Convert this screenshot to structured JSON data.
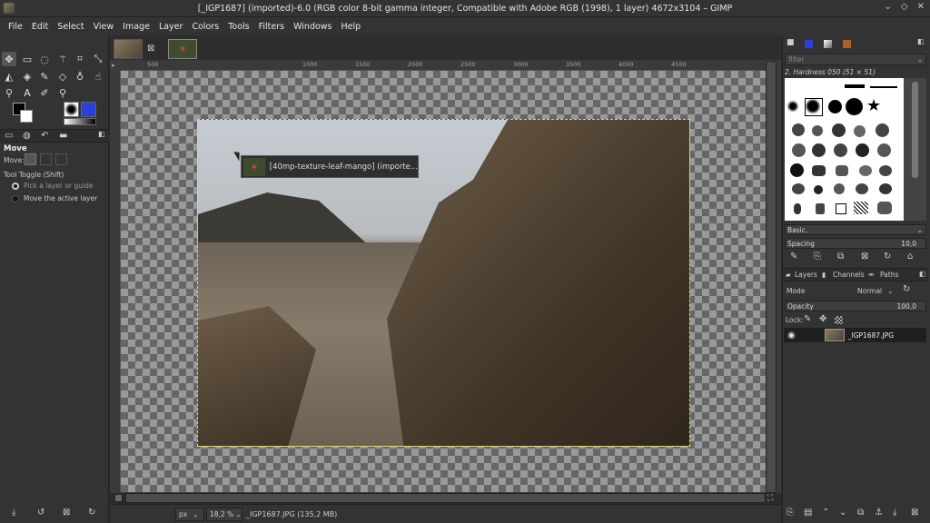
{
  "window": {
    "title": "[_IGP1687] (imported)-6.0 (RGB color 8-bit gamma integer, Compatible with Adobe RGB (1998), 1 layer) 4672x3104 – GIMP",
    "controls": [
      "⌄",
      "◇",
      "✕"
    ]
  },
  "menu": [
    "File",
    "Edit",
    "Select",
    "View",
    "Image",
    "Layer",
    "Colors",
    "Tools",
    "Filters",
    "Windows",
    "Help"
  ],
  "tool_options": {
    "title": "Move",
    "move_label": "Move:",
    "toggle_label": "Tool Toggle  (Shift)",
    "options": [
      {
        "label": "Pick a layer or guide",
        "selected": true
      },
      {
        "label": "Move the active layer",
        "selected": false
      }
    ]
  },
  "ruler_ticks": [
    "500",
    "1000",
    "1500",
    "2000",
    "2500",
    "3000",
    "3500",
    "4000",
    "4500"
  ],
  "tooltip": {
    "text": "[40mp-texture-leaf-mango] (importe..."
  },
  "status": {
    "unit": "px",
    "zoom": "18,2 %",
    "file": "_IGP1687.JPG (135,2 MB)"
  },
  "brushes": {
    "filter_placeholder": "filter",
    "selected_name": "2. Hardness 050 (51 × 51)",
    "preset": "Basic.",
    "spacing_label": "Spacing",
    "spacing_value": "10,0"
  },
  "layers": {
    "tabs": [
      "Layers",
      "Channels",
      "Paths"
    ],
    "mode_label": "Mode",
    "mode_value": "Normal",
    "opacity_label": "Opacity",
    "opacity_value": "100,0",
    "lock_label": "Lock:",
    "items": [
      {
        "name": "_IGP1687.JPG",
        "visible": true
      }
    ]
  }
}
